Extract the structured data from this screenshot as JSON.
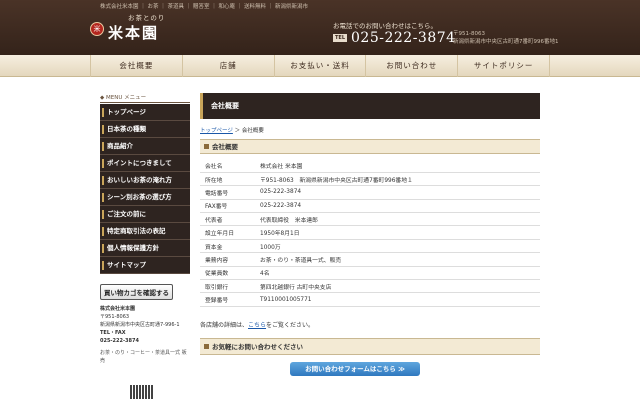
{
  "header": {
    "topline": "株式会社米本園 ｜ お茶 ｜ 茶道具 ｜ 贈答室 ｜ 和心庵 ｜ 送料無料 ｜ 新潟県新潟市",
    "logo_seal": "米",
    "logo_small": "お茶とのり",
    "logo_big": "米本園",
    "tel_note": "お電話でのお問い合わせはこちら。",
    "tel_badge": "TEL",
    "tel_number": "025-222-3874",
    "addr_line1": "〒951-8063",
    "addr_line2": "新潟県新潟市中央区古町通7番町996番地1"
  },
  "nav": {
    "items": [
      "会社概要",
      "店舗",
      "お支払い・送料",
      "お問い合わせ",
      "サイトポリシー"
    ]
  },
  "sidebar": {
    "menu_head": "◆ MENU メニュー",
    "items": [
      "トップページ",
      "日本茶の種類",
      "商品紹介",
      "ポイントにつきまして",
      "おいしいお茶の淹れ方",
      "シーン別お茶の選び方",
      "ご注文の前に",
      "特定商取引法の表記",
      "個人情報保護方針",
      "サイトマップ"
    ],
    "cart_button": "買い物カゴを確認する",
    "company": "株式会社米本園",
    "zip": "〒951-8063",
    "address": "新潟県新潟市中央区古町通7-996-1",
    "tel_fax": "TEL・FAX",
    "phone": "025-222-3874",
    "desc": "お茶・のり・コーヒー・茶道具一式 販売"
  },
  "main": {
    "page_title": "会社概要",
    "breadcrumb_home": "トップページ",
    "breadcrumb_sep": "＞",
    "breadcrumb_current": "会社概要",
    "section_title": "会社概要",
    "rows": [
      {
        "k": "会社名",
        "v": "株式会社 米本園"
      },
      {
        "k": "所在地",
        "v": "〒951-8063　新潟県新潟市中央区古町通7番町996番地１"
      },
      {
        "k": "電話番号",
        "v": "025-222-3874"
      },
      {
        "k": "FAX番号",
        "v": "025-222-3874"
      },
      {
        "k": "代表者",
        "v": "代表取締役　米本達郎"
      },
      {
        "k": "設立年月日",
        "v": "1950年8月1日"
      },
      {
        "k": "資本金",
        "v": "1000万"
      },
      {
        "k": "業務内容",
        "v": "お茶・のり・茶道具一式、販売"
      },
      {
        "k": "従業員数",
        "v": "4名"
      },
      {
        "k": "取引銀行",
        "v": "第四北越銀行 古町中央支店"
      },
      {
        "k": "登録番号",
        "v": "T9110001005771"
      }
    ],
    "detail_pre": "各店舗の詳細は、",
    "detail_link": "こちら",
    "detail_post": "をご覧ください。",
    "contact_title": "お気軽にお問い合わせください",
    "form_button": "お問い合わせフォームはこちら ≫"
  }
}
